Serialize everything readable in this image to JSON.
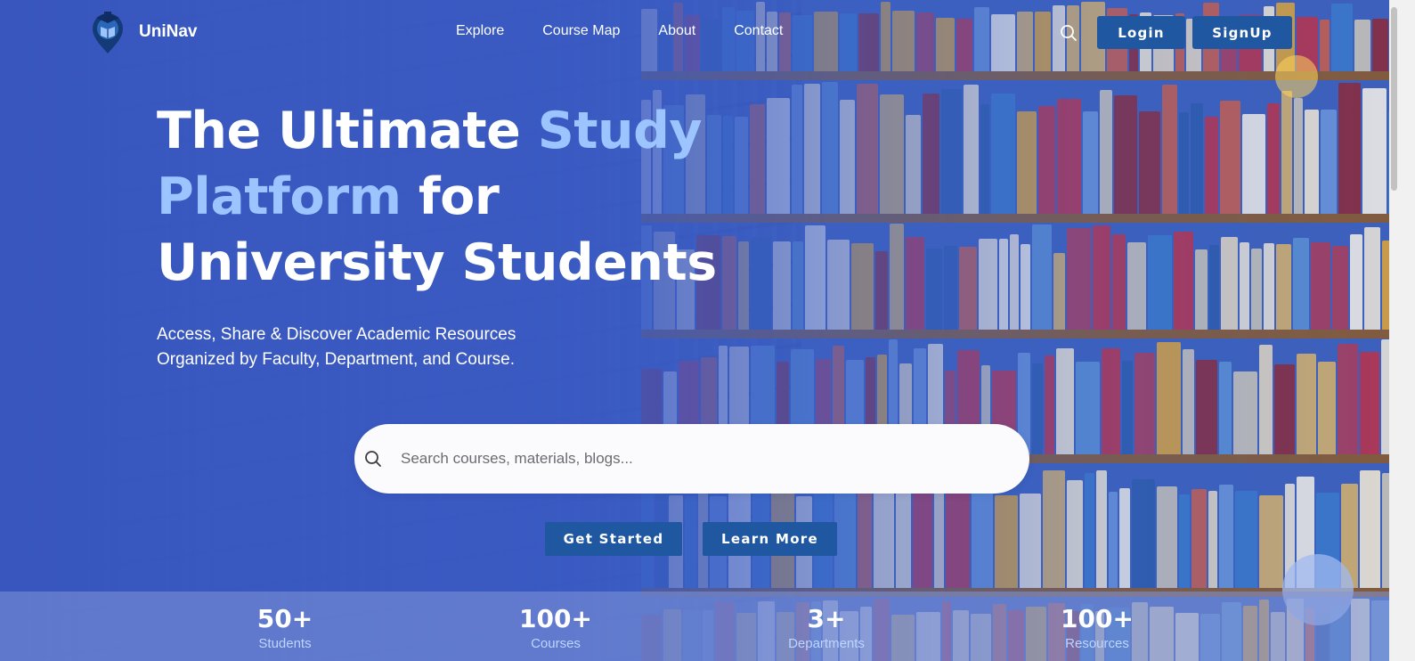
{
  "brand": {
    "name": "UniNav",
    "icon": "graduation-cap-book-icon"
  },
  "nav": {
    "links": [
      "Explore",
      "Course Map",
      "About",
      "Contact"
    ],
    "login_label": "Login",
    "signup_label": "SignUp"
  },
  "hero": {
    "title_part1": "The Ultimate ",
    "title_accent": "Study Platform",
    "title_part2": " for University Students",
    "subtitle": "Access, Share & Discover Academic Resources Organized by Faculty, Department, and Course."
  },
  "search": {
    "placeholder": "Search courses, materials, blogs...",
    "value": ""
  },
  "cta": {
    "primary_label": "Get Started",
    "secondary_label": "Learn More"
  },
  "stats": [
    {
      "value": "50+",
      "label": "Students"
    },
    {
      "value": "100+",
      "label": "Courses"
    },
    {
      "value": "3+",
      "label": "Departments"
    },
    {
      "value": "100+",
      "label": "Resources"
    }
  ],
  "colors": {
    "primary": "#1f58a0",
    "accent": "#9cc4ff",
    "overlay": "#3a5ac4"
  }
}
